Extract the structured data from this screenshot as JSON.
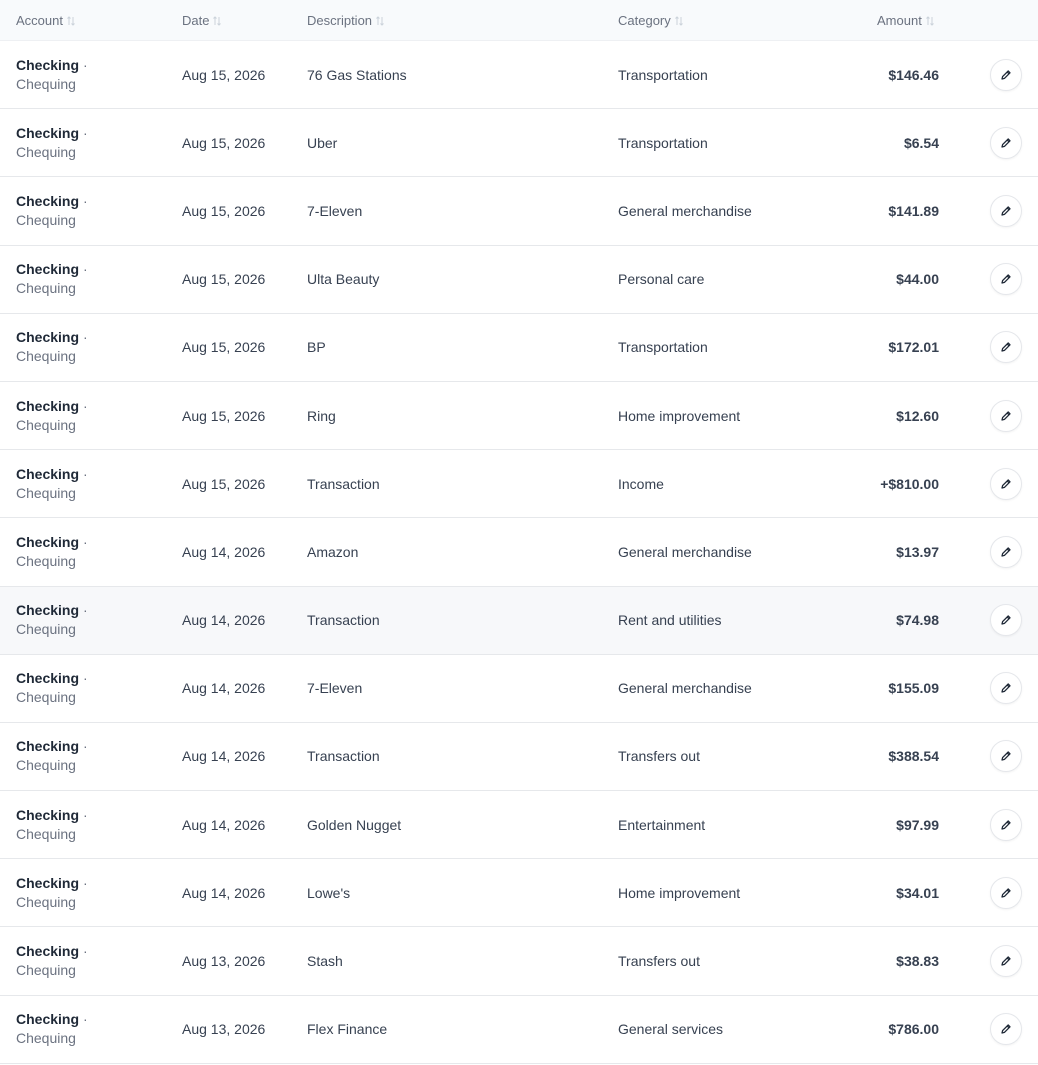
{
  "header": {
    "account": "Account",
    "date": "Date",
    "description": "Description",
    "category": "Category",
    "amount": "Amount"
  },
  "icons": {
    "sort": "sort-arrows-icon",
    "edit": "pencil-icon"
  },
  "rows": [
    {
      "account": "Checking",
      "separator": "·",
      "account_type": "Chequing",
      "date": "Aug 15, 2026",
      "description": "76 Gas Stations",
      "category": "Transportation",
      "amount": "$146.46"
    },
    {
      "account": "Checking",
      "separator": "·",
      "account_type": "Chequing",
      "date": "Aug 15, 2026",
      "description": "Uber",
      "category": "Transportation",
      "amount": "$6.54"
    },
    {
      "account": "Checking",
      "separator": "·",
      "account_type": "Chequing",
      "date": "Aug 15, 2026",
      "description": "7-Eleven",
      "category": "General merchandise",
      "amount": "$141.89"
    },
    {
      "account": "Checking",
      "separator": "·",
      "account_type": "Chequing",
      "date": "Aug 15, 2026",
      "description": "Ulta Beauty",
      "category": "Personal care",
      "amount": "$44.00"
    },
    {
      "account": "Checking",
      "separator": "·",
      "account_type": "Chequing",
      "date": "Aug 15, 2026",
      "description": "BP",
      "category": "Transportation",
      "amount": "$172.01"
    },
    {
      "account": "Checking",
      "separator": "·",
      "account_type": "Chequing",
      "date": "Aug 15, 2026",
      "description": "Ring",
      "category": "Home improvement",
      "amount": "$12.60"
    },
    {
      "account": "Checking",
      "separator": "·",
      "account_type": "Chequing",
      "date": "Aug 15, 2026",
      "description": "Transaction",
      "category": "Income",
      "amount": "+$810.00"
    },
    {
      "account": "Checking",
      "separator": "·",
      "account_type": "Chequing",
      "date": "Aug 14, 2026",
      "description": "Amazon",
      "category": "General merchandise",
      "amount": "$13.97"
    },
    {
      "account": "Checking",
      "separator": "·",
      "account_type": "Chequing",
      "date": "Aug 14, 2026",
      "description": "Transaction",
      "category": "Rent and utilities",
      "amount": "$74.98"
    },
    {
      "account": "Checking",
      "separator": "·",
      "account_type": "Chequing",
      "date": "Aug 14, 2026",
      "description": "7-Eleven",
      "category": "General merchandise",
      "amount": "$155.09"
    },
    {
      "account": "Checking",
      "separator": "·",
      "account_type": "Chequing",
      "date": "Aug 14, 2026",
      "description": "Transaction",
      "category": "Transfers out",
      "amount": "$388.54"
    },
    {
      "account": "Checking",
      "separator": "·",
      "account_type": "Chequing",
      "date": "Aug 14, 2026",
      "description": "Golden Nugget",
      "category": "Entertainment",
      "amount": "$97.99"
    },
    {
      "account": "Checking",
      "separator": "·",
      "account_type": "Chequing",
      "date": "Aug 14, 2026",
      "description": "Lowe's",
      "category": "Home improvement",
      "amount": "$34.01"
    },
    {
      "account": "Checking",
      "separator": "·",
      "account_type": "Chequing",
      "date": "Aug 13, 2026",
      "description": "Stash",
      "category": "Transfers out",
      "amount": "$38.83"
    },
    {
      "account": "Checking",
      "separator": "·",
      "account_type": "Chequing",
      "date": "Aug 13, 2026",
      "description": "Flex Finance",
      "category": "General services",
      "amount": "$786.00"
    }
  ]
}
